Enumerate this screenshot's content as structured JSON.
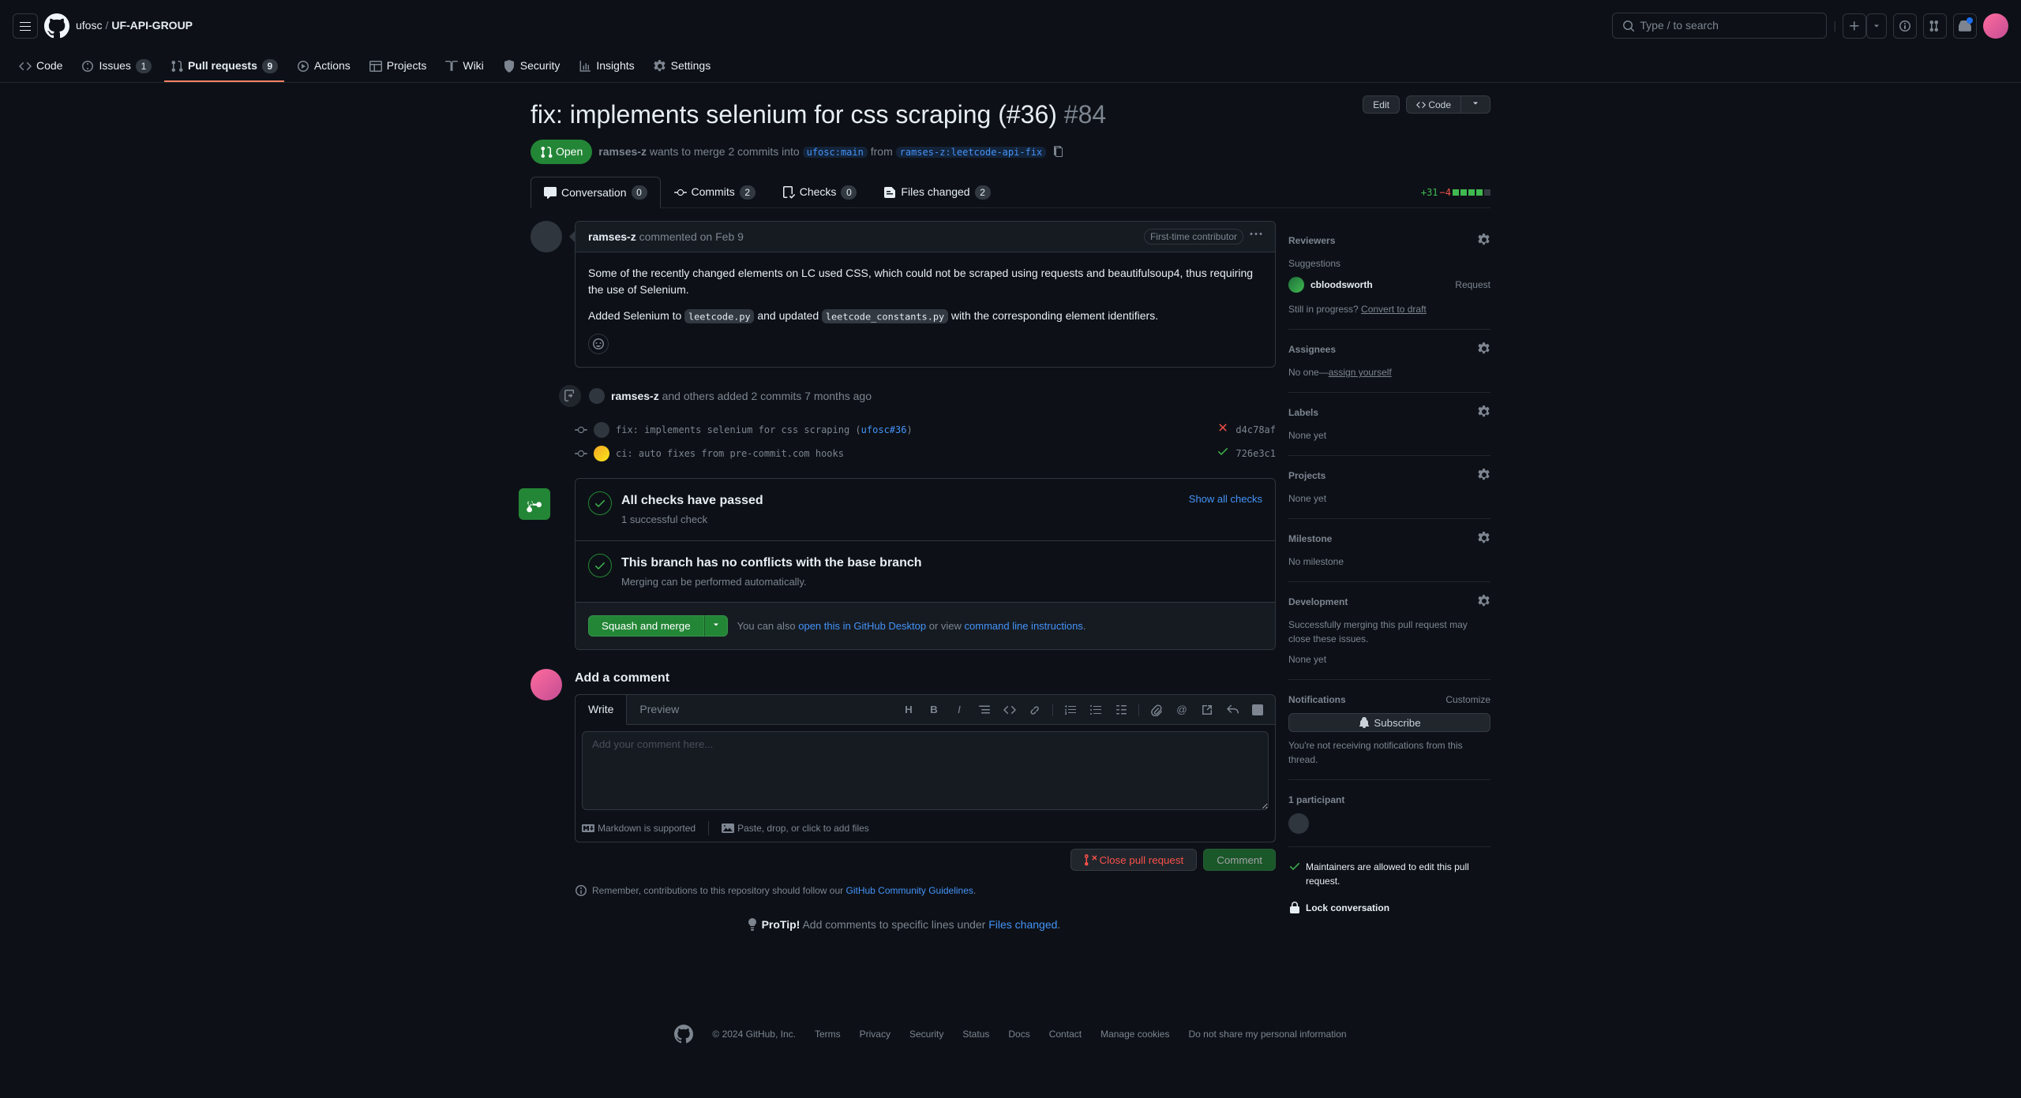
{
  "header": {
    "owner": "ufosc",
    "repo": "UF-API-GROUP",
    "search_placeholder": "Type / to search"
  },
  "repo_nav": {
    "code": "Code",
    "issues": "Issues",
    "issues_count": "1",
    "pulls": "Pull requests",
    "pulls_count": "9",
    "actions": "Actions",
    "projects": "Projects",
    "wiki": "Wiki",
    "security": "Security",
    "insights": "Insights",
    "settings": "Settings"
  },
  "pr": {
    "title": "fix: implements selenium for css scraping (#36)",
    "number": "#84",
    "state": "Open",
    "author": "ramses-z",
    "merge_desc_pre": "wants to merge 2 commits into",
    "base_branch": "ufosc:main",
    "from": "from",
    "head_branch": "ramses-z:leetcode-api-fix",
    "edit_btn": "Edit",
    "code_btn": "Code"
  },
  "tabs": {
    "conversation": "Conversation",
    "conversation_count": "0",
    "commits": "Commits",
    "commits_count": "2",
    "checks": "Checks",
    "checks_count": "0",
    "files": "Files changed",
    "files_count": "2",
    "additions": "+31",
    "deletions": "−4"
  },
  "comment": {
    "author": "ramses-z",
    "verb": "commented",
    "date": "on Feb 9",
    "label": "First-time contributor",
    "body_p1": "Some of the recently changed elements on LC used CSS, which could not be scraped using requests and beautifulsoup4, thus requiring the use of Selenium.",
    "body_p2_prefix": "Added Selenium to ",
    "body_p2_code1": "leetcode.py",
    "body_p2_mid": " and updated ",
    "body_p2_code2": "leetcode_constants.py",
    "body_p2_suffix": " with the corresponding element identifiers."
  },
  "push_event": {
    "summary_prefix": "ramses-z",
    "summary_mid": " and others added 2 commits ",
    "summary_ago": "7 months ago"
  },
  "commits": [
    {
      "msg": "fix: implements selenium for css scraping (",
      "msg_link": "ufosc#36",
      "msg_suffix": ")",
      "status": "x",
      "sha": "d4c78af"
    },
    {
      "msg": "ci: auto fixes from pre-commit.com hooks",
      "status": "check",
      "sha": "726e3c1"
    }
  ],
  "merge": {
    "checks_title": "All checks have passed",
    "checks_sub": "1 successful check",
    "show_all": "Show all checks",
    "conflict_title": "This branch has no conflicts with the base branch",
    "conflict_sub": "Merging can be performed automatically.",
    "squash_btn": "Squash and merge",
    "also_pre": "You can also ",
    "also_link1": "open this in GitHub Desktop",
    "also_mid": " or view ",
    "also_link2": "command line instructions"
  },
  "editor": {
    "heading": "Add a comment",
    "tab_write": "Write",
    "tab_preview": "Preview",
    "placeholder": "Add your comment here...",
    "markdown": "Markdown is supported",
    "paste": "Paste, drop, or click to add files",
    "close_btn": "Close pull request",
    "comment_btn": "Comment"
  },
  "info_note": {
    "prefix": "Remember, contributions to this repository should follow our ",
    "link": "GitHub Community Guidelines"
  },
  "protip": {
    "label": "ProTip!",
    "text": " Add comments to specific lines under ",
    "link": "Files changed"
  },
  "sidebar": {
    "reviewers_title": "Reviewers",
    "suggestions_label": "Suggestions",
    "suggestion_user": "cbloodsworth",
    "request": "Request",
    "still_progress": "Still in progress? ",
    "convert_draft": "Convert to draft",
    "assignees_title": "Assignees",
    "assignees_none_pre": "No one—",
    "assignees_link": "assign yourself",
    "labels_title": "Labels",
    "none_yet": "None yet",
    "projects_title": "Projects",
    "milestone_title": "Milestone",
    "no_milestone": "No milestone",
    "dev_title": "Development",
    "dev_desc": "Successfully merging this pull request may close these issues.",
    "notif_title": "Notifications",
    "customize": "Customize",
    "subscribe": "Subscribe",
    "notif_desc": "You're not receiving notifications from this thread.",
    "participants": "1 participant",
    "maintainers": "Maintainers are allowed to edit this pull request.",
    "lock": "Lock conversation"
  },
  "footer": {
    "copyright": "© 2024 GitHub, Inc.",
    "terms": "Terms",
    "privacy": "Privacy",
    "security": "Security",
    "status": "Status",
    "docs": "Docs",
    "contact": "Contact",
    "cookies": "Manage cookies",
    "dnsmpi": "Do not share my personal information"
  }
}
